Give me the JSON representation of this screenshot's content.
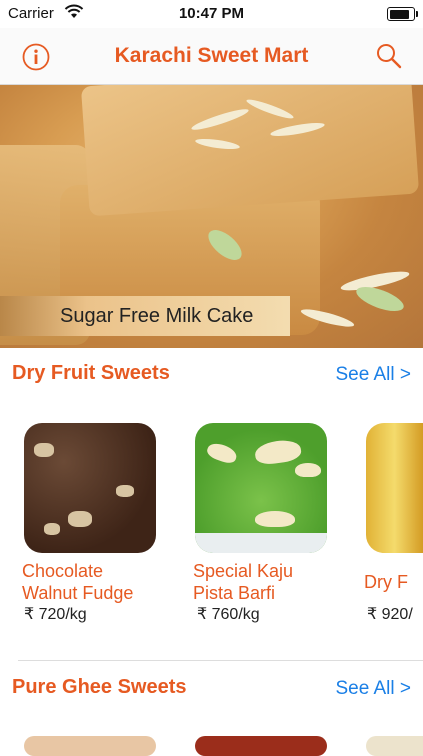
{
  "status_bar": {
    "carrier": "Carrier",
    "time": "10:47 PM"
  },
  "navbar": {
    "title": "Karachi Sweet Mart",
    "info_icon": "info-icon",
    "search_icon": "search-icon",
    "accent": "#e65a22"
  },
  "banner": {
    "caption": "Sugar Free Milk Cake"
  },
  "sections": [
    {
      "title": "Dry Fruit Sweets",
      "see_all": "See All >",
      "items": [
        {
          "name_line1": "Chocolate",
          "name_line2": "Walnut Fudge",
          "price": "₹ 720/kg"
        },
        {
          "name_line1": "Special Kaju",
          "name_line2": "Pista Barfi",
          "price": "₹ 760/kg"
        },
        {
          "name_line1": "Dry F",
          "name_line2": "",
          "price": "₹ 920/"
        }
      ]
    },
    {
      "title": "Pure Ghee Sweets",
      "see_all": "See All >"
    }
  ],
  "colors": {
    "link": "#1a7fe6",
    "divider": "#dddddd"
  }
}
